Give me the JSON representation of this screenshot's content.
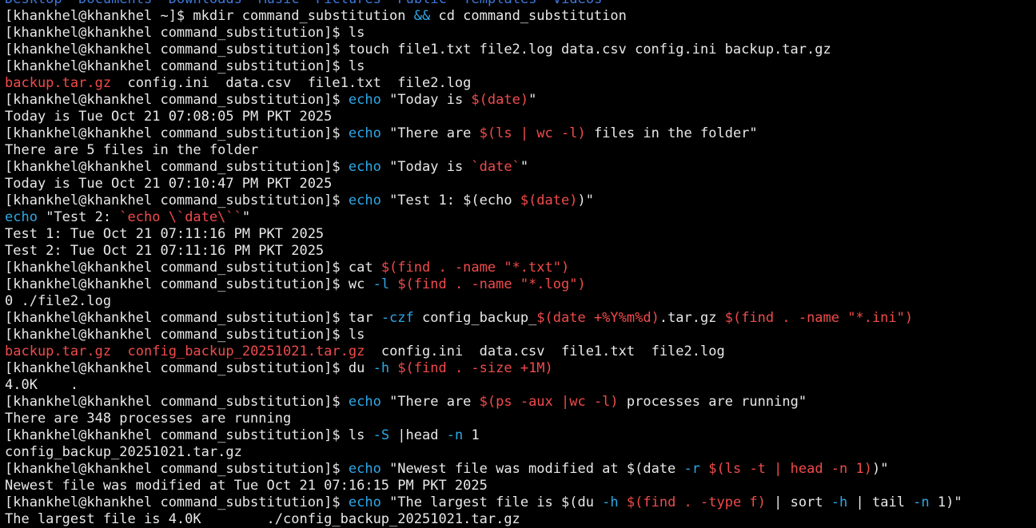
{
  "colors": {
    "bg": "#000000",
    "fg": "#e8e8e8",
    "cmd": "#2ea8e6",
    "sub": "#f04b4b",
    "file": "#f04b4b",
    "dir": "#3c78d8"
  },
  "terminal": {
    "lines": [
      [
        [
          "Desktop",
          "dir"
        ],
        [
          "  ",
          "fg"
        ],
        [
          "Documents",
          "dir"
        ],
        [
          "  ",
          "fg"
        ],
        [
          "Downloads",
          "dir"
        ],
        [
          "  ",
          "fg"
        ],
        [
          "Music",
          "dir"
        ],
        [
          "  ",
          "fg"
        ],
        [
          "Pictures",
          "dir"
        ],
        [
          "  ",
          "fg"
        ],
        [
          "Public",
          "dir"
        ],
        [
          "  ",
          "fg"
        ],
        [
          "Templates",
          "dir"
        ],
        [
          "  ",
          "fg"
        ],
        [
          "Videos",
          "dir"
        ]
      ],
      [
        [
          "[khankhel@khankhel ~]$ mkdir command_substitution ",
          "fg"
        ],
        [
          "&&",
          "cmd"
        ],
        [
          " cd command_substitution",
          "fg"
        ]
      ],
      [
        [
          "[khankhel@khankhel command_substitution]$ ls",
          "fg"
        ]
      ],
      [
        [
          "[khankhel@khankhel command_substitution]$ touch file1.txt file2.log data.csv config.ini backup.tar.gz",
          "fg"
        ]
      ],
      [
        [
          "[khankhel@khankhel command_substitution]$ ls",
          "fg"
        ]
      ],
      [
        [
          "backup.tar.gz",
          "file"
        ],
        [
          "  config.ini  data.csv  file1.txt  file2.log",
          "fg"
        ]
      ],
      [
        [
          "[khankhel@khankhel command_substitution]$ ",
          "fg"
        ],
        [
          "echo",
          "cmd"
        ],
        [
          " \"Today is ",
          "fg"
        ],
        [
          "$(date)",
          "sub"
        ],
        [
          "\"",
          "fg"
        ]
      ],
      [
        [
          "Today is Tue Oct 21 07:08:05 PM PKT 2025",
          "fg"
        ]
      ],
      [
        [
          "[khankhel@khankhel command_substitution]$ ",
          "fg"
        ],
        [
          "echo",
          "cmd"
        ],
        [
          " \"There are ",
          "fg"
        ],
        [
          "$(ls | wc -l)",
          "sub"
        ],
        [
          " files in the folder\"",
          "fg"
        ]
      ],
      [
        [
          "There are 5 files in the folder",
          "fg"
        ]
      ],
      [
        [
          "[khankhel@khankhel command_substitution]$ ",
          "fg"
        ],
        [
          "echo",
          "cmd"
        ],
        [
          " \"Today is ",
          "fg"
        ],
        [
          "`date`",
          "sub"
        ],
        [
          "\"",
          "fg"
        ]
      ],
      [
        [
          "Today is Tue Oct 21 07:10:47 PM PKT 2025",
          "fg"
        ]
      ],
      [
        [
          "[khankhel@khankhel command_substitution]$ ",
          "fg"
        ],
        [
          "echo",
          "cmd"
        ],
        [
          " \"Test 1: $(echo ",
          "fg"
        ],
        [
          "$(date)",
          "sub"
        ],
        [
          ")\"",
          "fg"
        ]
      ],
      [
        [
          "echo",
          "cmd"
        ],
        [
          " \"Test 2: ",
          "fg"
        ],
        [
          "`echo \\`date\\``",
          "sub"
        ],
        [
          "\"",
          "fg"
        ]
      ],
      [
        [
          "Test 1: Tue Oct 21 07:11:16 PM PKT 2025",
          "fg"
        ]
      ],
      [
        [
          "Test 2: Tue Oct 21 07:11:16 PM PKT 2025",
          "fg"
        ]
      ],
      [
        [
          "[khankhel@khankhel command_substitution]$ cat ",
          "fg"
        ],
        [
          "$(find . -name \"*.txt\")",
          "sub"
        ]
      ],
      [
        [
          "[khankhel@khankhel command_substitution]$ wc ",
          "fg"
        ],
        [
          "-l",
          "cmd"
        ],
        [
          " ",
          "fg"
        ],
        [
          "$(find . -name \"*.log\")",
          "sub"
        ]
      ],
      [
        [
          "0 ./file2.log",
          "fg"
        ]
      ],
      [
        [
          "[khankhel@khankhel command_substitution]$ tar ",
          "fg"
        ],
        [
          "-czf",
          "cmd"
        ],
        [
          " config_backup_",
          "fg"
        ],
        [
          "$(date +%Y%m%d)",
          "sub"
        ],
        [
          ".tar.gz ",
          "fg"
        ],
        [
          "$(find . -name \"*.ini\")",
          "sub"
        ]
      ],
      [
        [
          "[khankhel@khankhel command_substitution]$ ls",
          "fg"
        ]
      ],
      [
        [
          "backup.tar.gz",
          "file"
        ],
        [
          "  ",
          "fg"
        ],
        [
          "config_backup_20251021.tar.gz",
          "file"
        ],
        [
          "  config.ini  data.csv  file1.txt  file2.log",
          "fg"
        ]
      ],
      [
        [
          "[khankhel@khankhel command_substitution]$ du ",
          "fg"
        ],
        [
          "-h",
          "cmd"
        ],
        [
          " ",
          "fg"
        ],
        [
          "$(find . -size +1M)",
          "sub"
        ]
      ],
      [
        [
          "4.0K    .",
          "fg"
        ]
      ],
      [
        [
          "[khankhel@khankhel command_substitution]$ ",
          "fg"
        ],
        [
          "echo",
          "cmd"
        ],
        [
          " \"There are ",
          "fg"
        ],
        [
          "$(ps -aux |wc -l)",
          "sub"
        ],
        [
          " processes are running\"",
          "fg"
        ]
      ],
      [
        [
          "There are 348 processes are running",
          "fg"
        ]
      ],
      [
        [
          "[khankhel@khankhel command_substitution]$ ls ",
          "fg"
        ],
        [
          "-S",
          "cmd"
        ],
        [
          " |head ",
          "fg"
        ],
        [
          "-n",
          "cmd"
        ],
        [
          " 1",
          "fg"
        ]
      ],
      [
        [
          "config_backup_20251021.tar.gz",
          "fg"
        ]
      ],
      [
        [
          "[khankhel@khankhel command_substitution]$ ",
          "fg"
        ],
        [
          "echo",
          "cmd"
        ],
        [
          " \"Newest file was modified at $(date ",
          "fg"
        ],
        [
          "-r",
          "cmd"
        ],
        [
          " ",
          "fg"
        ],
        [
          "$(ls -t | head -n 1)",
          "sub"
        ],
        [
          ")\"",
          "fg"
        ]
      ],
      [
        [
          "Newest file was modified at Tue Oct 21 07:16:15 PM PKT 2025",
          "fg"
        ]
      ],
      [
        [
          "[khankhel@khankhel command_substitution]$ ",
          "fg"
        ],
        [
          "echo",
          "cmd"
        ],
        [
          " \"The largest file is $(du ",
          "fg"
        ],
        [
          "-h",
          "cmd"
        ],
        [
          " ",
          "fg"
        ],
        [
          "$(find . -type f)",
          "sub"
        ],
        [
          " | sort ",
          "fg"
        ],
        [
          "-h",
          "cmd"
        ],
        [
          " | tail ",
          "fg"
        ],
        [
          "-n",
          "cmd"
        ],
        [
          " 1)\"",
          "fg"
        ]
      ],
      [
        [
          "The largest file is 4.0K        ./config_backup_20251021.tar.gz",
          "fg"
        ]
      ]
    ]
  }
}
